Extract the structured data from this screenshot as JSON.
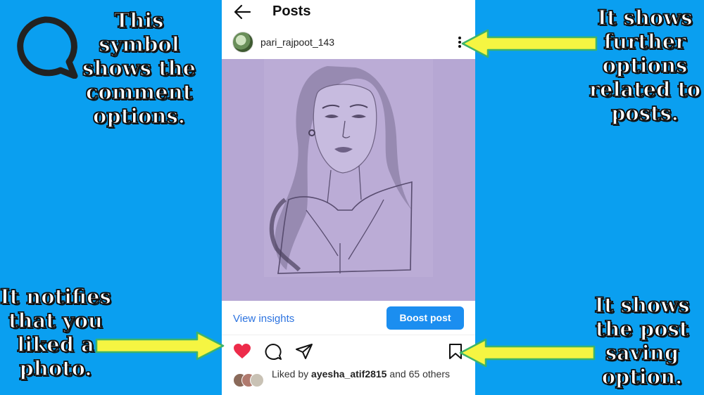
{
  "annotations": {
    "comment": "This\nsymbol\nshows the\ncomment\noptions.",
    "options": "It shows\nfurther\noptions\nrelated to\nposts.",
    "liked": "It notifies\nthat you\nliked a\nphoto.",
    "save": "It shows\nthe post\nsaving\noption."
  },
  "header": {
    "title": "Posts",
    "back_icon": "arrow-left-icon"
  },
  "post": {
    "username": "pari_rajpoot_143",
    "more_icon": "vertical-dots-icon",
    "view_insights": "View insights",
    "boost_label": "Boost post",
    "actions": [
      "heart-filled-icon",
      "comment-icon",
      "share-icon",
      "bookmark-icon"
    ],
    "liked_prefix": "Liked by",
    "liked_user": "ayesha_atif2815",
    "liked_suffix": "and 65 others"
  },
  "colors": {
    "background": "#0a9ff0",
    "arrow_fill": "#f5f542",
    "arrow_stroke": "#3db36a",
    "heart": "#ed2b4a",
    "boost": "#1b8ef0",
    "link": "#2d74e0"
  }
}
